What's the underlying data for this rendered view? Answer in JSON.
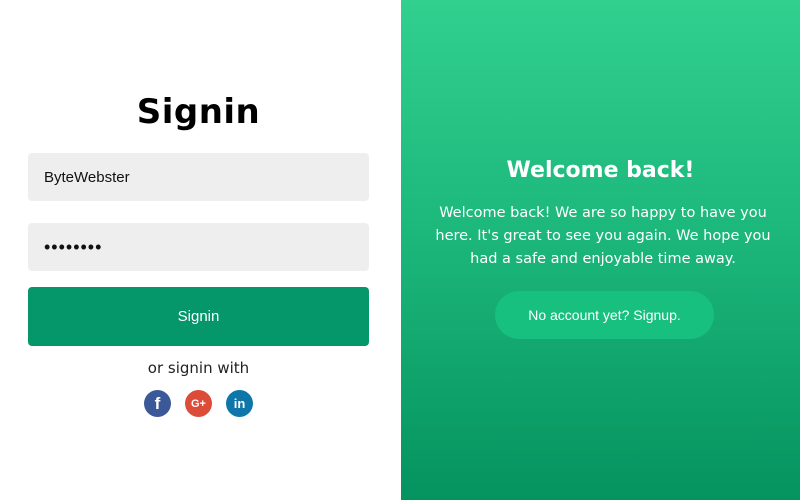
{
  "signin": {
    "title": "Signin",
    "username_value": "ByteWebster",
    "password_value": "••••••••",
    "button_label": "Signin",
    "alt_text": "or signin with",
    "social_icons": [
      "facebook-icon",
      "google-plus-icon",
      "linkedin-icon"
    ],
    "social_glyphs": {
      "facebook": "f",
      "google": "G+",
      "linkedin": "in"
    }
  },
  "welcome": {
    "title": "Welcome back!",
    "text": "Welcome back! We are so happy to have you here. It's great to see you again. We hope you had a safe and enjoyable time away.",
    "button_label": "No account yet? Signup."
  },
  "colors": {
    "primary_green": "#059669",
    "gradient_top": "#31d08f",
    "gradient_bottom": "#05935f",
    "field_bg": "#eeeeee",
    "facebook": "#3b5998",
    "google": "#dd4b39",
    "linkedin": "#0e76a8"
  }
}
